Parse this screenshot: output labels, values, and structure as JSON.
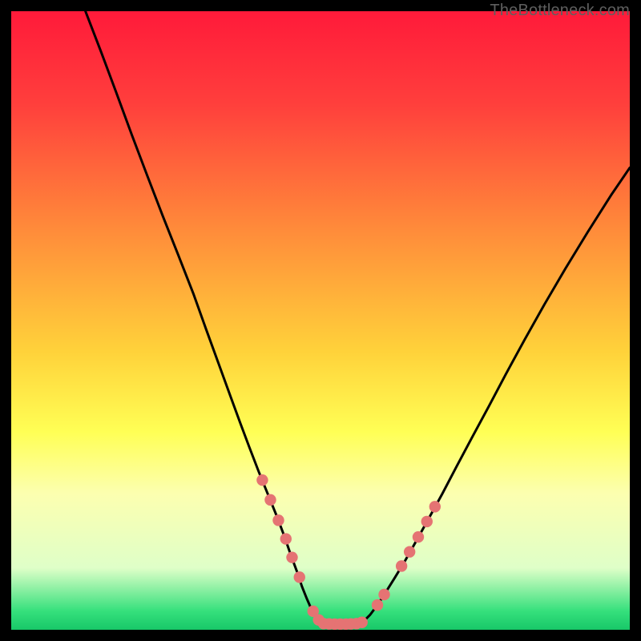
{
  "watermark": "TheBottleneck.com",
  "chart_data": {
    "type": "line",
    "title": "",
    "xlabel": "",
    "ylabel": "",
    "xlim": [
      0,
      100
    ],
    "ylim": [
      0,
      100
    ],
    "grid": false,
    "legend": false,
    "gradient_stops": [
      {
        "offset": 0.0,
        "color": "#ff1a3a"
      },
      {
        "offset": 0.15,
        "color": "#ff3f3c"
      },
      {
        "offset": 0.35,
        "color": "#ff8a3a"
      },
      {
        "offset": 0.55,
        "color": "#ffd23a"
      },
      {
        "offset": 0.68,
        "color": "#ffff55"
      },
      {
        "offset": 0.78,
        "color": "#fcffb0"
      },
      {
        "offset": 0.9,
        "color": "#dfffc8"
      },
      {
        "offset": 0.97,
        "color": "#35e07c"
      },
      {
        "offset": 1.0,
        "color": "#18c768"
      }
    ],
    "series": [
      {
        "name": "left-curve",
        "x": [
          12.0,
          14.5,
          17.0,
          19.5,
          22.0,
          24.5,
          27.0,
          29.5,
          31.5,
          33.5,
          35.5,
          37.0,
          38.5,
          40.0,
          41.5,
          43.0,
          44.2,
          45.2,
          46.2,
          47.0,
          47.8,
          48.5,
          49.2,
          49.8,
          50.4
        ],
        "y": [
          100.0,
          93.5,
          86.8,
          80.0,
          73.4,
          66.9,
          60.6,
          54.2,
          48.6,
          43.1,
          37.6,
          33.5,
          29.5,
          25.6,
          21.9,
          18.2,
          15.0,
          12.1,
          9.4,
          7.0,
          5.0,
          3.4,
          2.2,
          1.3,
          1.0
        ]
      },
      {
        "name": "floor",
        "x": [
          50.4,
          50.8,
          51.3,
          52.0,
          52.7,
          53.4,
          54.1,
          54.8,
          55.5,
          56.2,
          56.8
        ],
        "y": [
          1.0,
          0.95,
          0.92,
          0.9,
          0.9,
          0.9,
          0.9,
          0.92,
          0.95,
          1.0,
          1.2
        ]
      },
      {
        "name": "right-curve",
        "x": [
          56.8,
          58.0,
          59.2,
          60.5,
          62.0,
          63.7,
          65.5,
          67.5,
          69.7,
          72.0,
          74.5,
          77.2,
          80.0,
          83.0,
          86.2,
          89.6,
          93.2,
          97.0,
          100.0
        ],
        "y": [
          1.2,
          2.4,
          4.0,
          6.0,
          8.4,
          11.2,
          14.4,
          18.0,
          22.0,
          26.4,
          31.1,
          36.1,
          41.4,
          46.9,
          52.6,
          58.4,
          64.3,
          70.3,
          74.7
        ]
      }
    ],
    "markers": {
      "name": "salmon-dots",
      "color": "#e57373",
      "points": [
        {
          "x": 40.6,
          "y": 24.2
        },
        {
          "x": 41.9,
          "y": 21.0
        },
        {
          "x": 43.2,
          "y": 17.7
        },
        {
          "x": 44.4,
          "y": 14.7
        },
        {
          "x": 45.4,
          "y": 11.7
        },
        {
          "x": 46.6,
          "y": 8.5
        },
        {
          "x": 48.8,
          "y": 3.0
        },
        {
          "x": 49.7,
          "y": 1.6
        },
        {
          "x": 50.5,
          "y": 1.0
        },
        {
          "x": 51.4,
          "y": 0.95
        },
        {
          "x": 52.3,
          "y": 0.92
        },
        {
          "x": 53.2,
          "y": 0.92
        },
        {
          "x": 54.1,
          "y": 0.92
        },
        {
          "x": 54.9,
          "y": 0.95
        },
        {
          "x": 55.8,
          "y": 1.0
        },
        {
          "x": 56.7,
          "y": 1.2
        },
        {
          "x": 59.2,
          "y": 4.0
        },
        {
          "x": 60.3,
          "y": 5.7
        },
        {
          "x": 63.1,
          "y": 10.3
        },
        {
          "x": 64.4,
          "y": 12.6
        },
        {
          "x": 65.8,
          "y": 15.0
        },
        {
          "x": 67.2,
          "y": 17.5
        },
        {
          "x": 68.5,
          "y": 19.9
        }
      ]
    }
  }
}
